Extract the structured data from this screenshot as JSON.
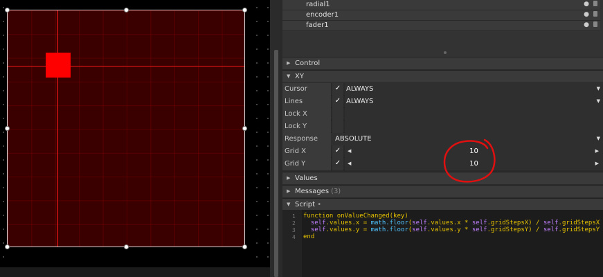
{
  "tree": {
    "items": [
      {
        "label": "radial1"
      },
      {
        "label": "encoder1"
      },
      {
        "label": "fader1"
      }
    ]
  },
  "sections": {
    "control": "Control",
    "xy": "XY",
    "values": "Values",
    "messages": "Messages",
    "messages_count": "(3)",
    "script": "Script",
    "script_marker": "•"
  },
  "xy": {
    "cursor": {
      "label": "Cursor",
      "check": "✓",
      "value": "ALWAYS"
    },
    "lines": {
      "label": "Lines",
      "check": "✓",
      "value": "ALWAYS"
    },
    "lock_x": {
      "label": "Lock X"
    },
    "lock_y": {
      "label": "Lock Y"
    },
    "response": {
      "label": "Response",
      "value": "ABSOLUTE"
    },
    "grid_x": {
      "label": "Grid X",
      "check": "✓",
      "value": "10"
    },
    "grid_y": {
      "label": "Grid Y",
      "check": "✓",
      "value": "10"
    }
  },
  "script": {
    "line_numbers": [
      "1",
      "2",
      "3",
      "4"
    ],
    "line1_kw": "function",
    "line1_rest": " onValueChanged(key)",
    "line2_a": "  ",
    "line2_self1": "self",
    "line2_b": ".values.x = ",
    "line2_fn": "math.floor",
    "line2_c": "(",
    "line2_self2": "self",
    "line2_d": ".values.x * ",
    "line2_self3": "self",
    "line2_e": ".gridStepsX) / ",
    "line2_self4": "self",
    "line2_f": ".gridStepsX",
    "line3_a": "  ",
    "line3_self1": "self",
    "line3_b": ".values.y = ",
    "line3_fn": "math.floor",
    "line3_c": "(",
    "line3_self2": "self",
    "line3_d": ".values.y * ",
    "line3_self3": "self",
    "line3_e": ".gridStepsY) / ",
    "line3_self4": "self",
    "line3_f": ".gridStepsY",
    "line4_kw": "end"
  },
  "icons": {
    "eye": "●",
    "tri_right": "▶",
    "tri_down": "▼",
    "arrow_left": "◀",
    "arrow_right": "▶"
  },
  "colors": {
    "accent_red": "#ff0000",
    "grid_bg": "#3a0000",
    "annotation": "#e01010"
  }
}
